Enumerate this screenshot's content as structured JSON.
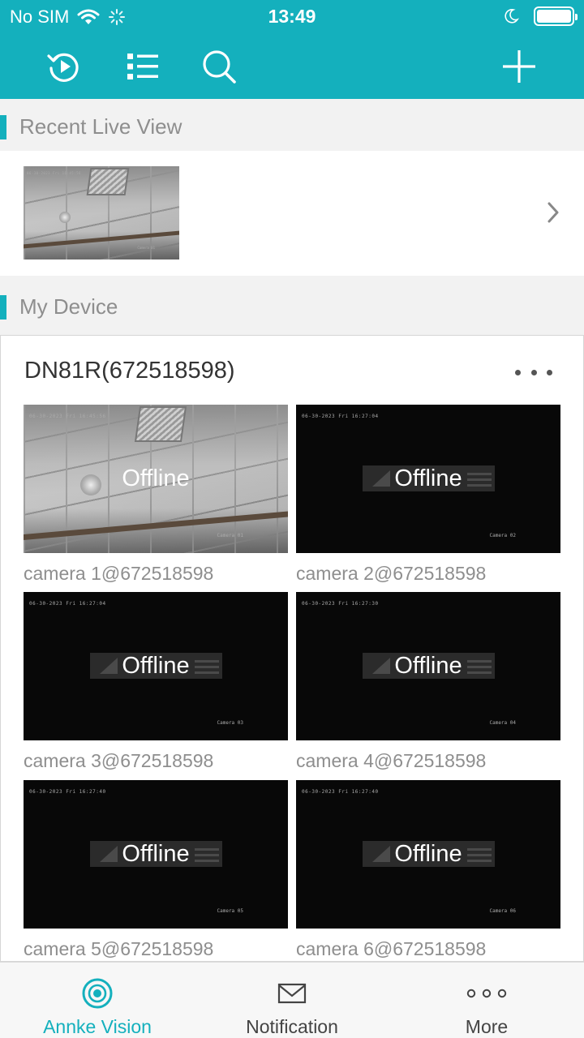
{
  "status_bar": {
    "carrier": "No SIM",
    "time": "13:49"
  },
  "toolbar": {
    "icons": [
      "playback-icon",
      "list-icon",
      "search-icon",
      "plus-icon"
    ]
  },
  "recent_live_view": {
    "section_title": "Recent Live View",
    "thumbnail_overlay": "06-30-2023 Fri 16:45:56",
    "thumbnail_camera": "Camera 01"
  },
  "my_device": {
    "section_title": "My Device",
    "device_name": "DN81R(672518598)",
    "cameras": [
      {
        "label": "camera 1@672518598",
        "status": "Offline",
        "osd": "06-30-2023 Fri 16:45:56",
        "osd_cam": "Camera 01"
      },
      {
        "label": "camera 2@672518598",
        "status": "Offline",
        "osd": "06-30-2023 Fri 16:27:04",
        "osd_cam": "Camera 02"
      },
      {
        "label": "camera 3@672518598",
        "status": "Offline",
        "osd": "06-30-2023 Fri 16:27:04",
        "osd_cam": "Camera 03"
      },
      {
        "label": "camera 4@672518598",
        "status": "Offline",
        "osd": "06-30-2023 Fri 16:27:30",
        "osd_cam": "Camera 04"
      },
      {
        "label": "camera 5@672518598",
        "status": "Offline",
        "osd": "06-30-2023 Fri 16:27:40",
        "osd_cam": "Camera 05"
      },
      {
        "label": "camera 6@672518598",
        "status": "Offline",
        "osd": "06-30-2023 Fri 16:27:40",
        "osd_cam": "Camera 06"
      }
    ]
  },
  "bottom_nav": {
    "items": [
      {
        "label": "Annke Vision",
        "icon": "live-view-icon",
        "active": true
      },
      {
        "label": "Notification",
        "icon": "envelope-icon",
        "active": false
      },
      {
        "label": "More",
        "icon": "more-dots-icon",
        "active": false
      }
    ]
  },
  "colors": {
    "accent": "#14b0bd",
    "section_text": "#8e8e8e",
    "offline_banner": "#2b2b2b"
  }
}
